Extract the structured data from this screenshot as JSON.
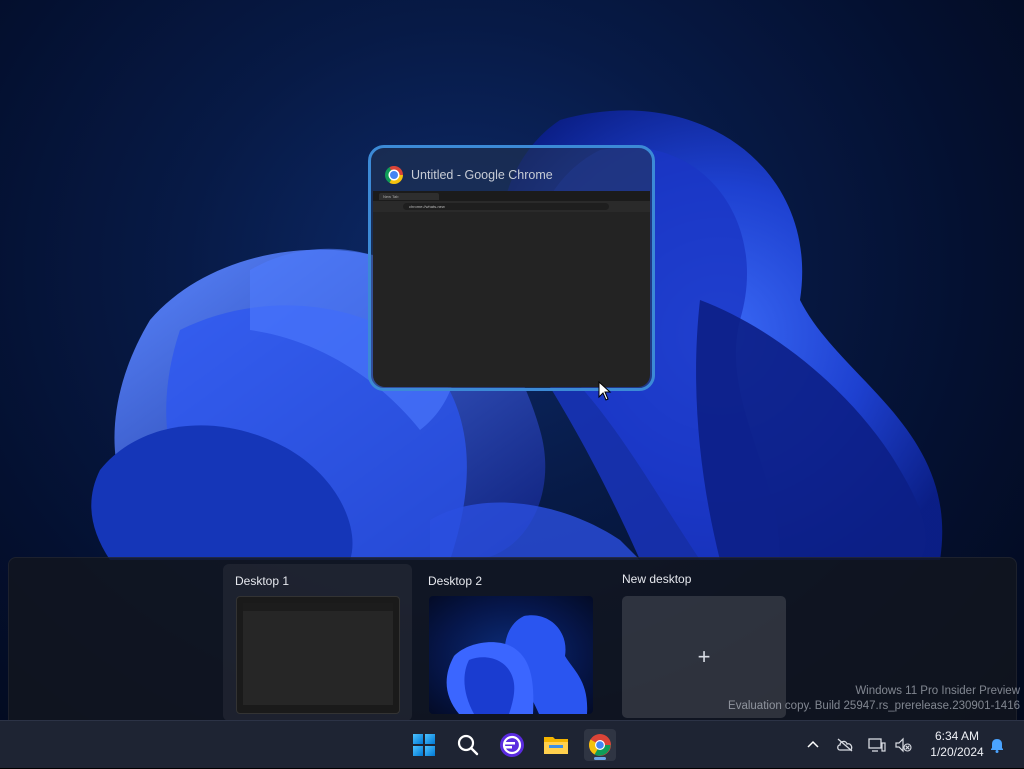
{
  "task_view": {
    "window": {
      "title": "Untitled - Google Chrome",
      "preview_tab": "New Tab",
      "preview_address": "chrome://whats-new"
    }
  },
  "desktops": {
    "items": [
      {
        "label": "Desktop 1"
      },
      {
        "label": "Desktop 2"
      }
    ],
    "new_desktop_label": "New desktop",
    "new_desktop_symbol": "+"
  },
  "watermark": {
    "line1": "Windows 11 Pro Insider Preview",
    "line2": "Evaluation copy. Build 25947.rs_prerelease.230901-1416"
  },
  "taskbar": {
    "pinned": [
      "start-icon",
      "search-icon",
      "app-icon",
      "file-explorer-icon",
      "chrome-icon"
    ],
    "tray": {
      "time": "6:34 AM",
      "date": "1/20/2024"
    }
  },
  "colors": {
    "accent": "#3c8ad6",
    "taskbar": "#1e2433"
  }
}
